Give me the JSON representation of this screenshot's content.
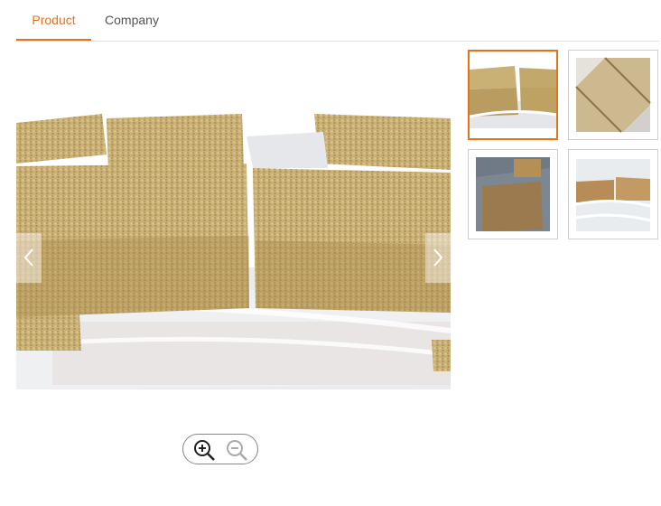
{
  "tabs": [
    {
      "label": "Product",
      "active": true
    },
    {
      "label": "Company",
      "active": false
    }
  ],
  "colors": {
    "accent": "#e8711c",
    "tab_text": "#555555",
    "divider": "#e3e3e3",
    "thumb_border": "#cfcfcf"
  },
  "gallery": {
    "main_image": "rice-crispy-blocks-on-plastic",
    "thumbnails": [
      {
        "image": "stacked-crispy-blocks",
        "selected": true
      },
      {
        "image": "crispy-block-closeup",
        "selected": false
      },
      {
        "image": "block-on-conveyor",
        "selected": false
      },
      {
        "image": "block-slices-in-bag",
        "selected": false
      }
    ],
    "controls": {
      "prev": "chevron-left-icon",
      "next": "chevron-right-icon",
      "zoom_in": "zoom-in-icon",
      "zoom_out": "zoom-out-icon"
    }
  }
}
